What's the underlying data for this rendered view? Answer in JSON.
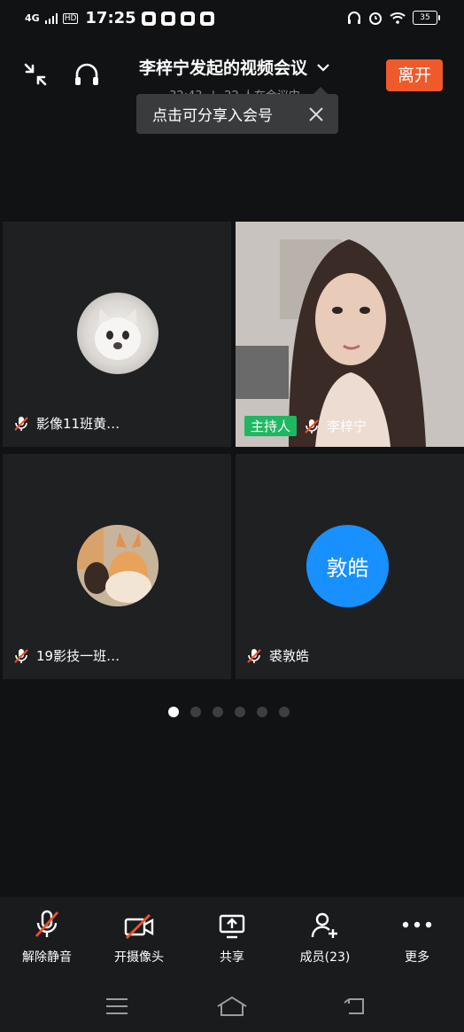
{
  "status_bar": {
    "network": "4G",
    "signal_badge": "HD",
    "time": "17:25",
    "battery": "35"
  },
  "header": {
    "title": "李梓宁发起的视频会议",
    "duration": "32:43",
    "participants_status": "22 人在会议中",
    "leave_label": "离开"
  },
  "tooltip": {
    "text": "点击可分享入会号"
  },
  "tiles": [
    {
      "name": "影像11班黄…",
      "muted": true,
      "avatar": "cat-photo"
    },
    {
      "name": "李梓宁",
      "muted": true,
      "host_label": "主持人",
      "video": "camera-feed"
    },
    {
      "name": "19影技一班…",
      "muted": true,
      "avatar": "dog-photo"
    },
    {
      "name": "裘敦皓",
      "muted": true,
      "avatar_text": "敦皓",
      "avatar_color": "#1890ff"
    }
  ],
  "pager": {
    "count": 6,
    "active": 0
  },
  "toolbar": {
    "unmute_label": "解除静音",
    "camera_label": "开摄像头",
    "share_label": "共享",
    "members_label": "成员(23)",
    "more_label": "更多"
  },
  "colors": {
    "accent": "#f05a2b",
    "host_badge": "#1fb760",
    "mute_slash": "#f0502a"
  }
}
